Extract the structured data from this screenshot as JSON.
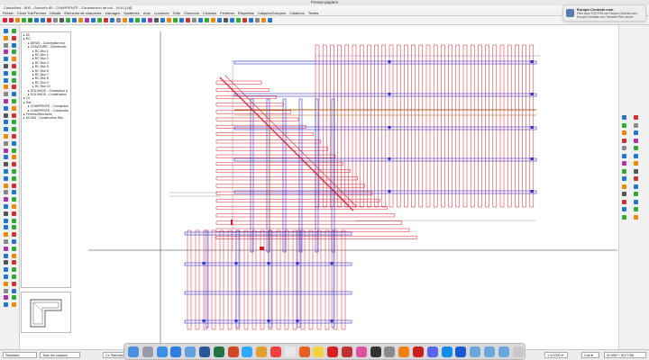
{
  "window": {
    "title": "Presse-papiers"
  },
  "app": {
    "line": "CadwWork - 806 - Oaknut's 80 - CHARPENTE - Construction de toit - 16:01 [48]"
  },
  "menu": {
    "items": [
      "Fichier",
      "Choix Toit/Fermes",
      "Détails",
      "Éléments de charpente",
      "Usinages",
      "Systèmes",
      "Auto",
      "Lucarnes",
      "Toits",
      "Chevrons",
      "Cloisons",
      "Fenêtres",
      "Étiquettes",
      "Calques/Groupes",
      "Cotations",
      "Textes"
    ]
  },
  "notification": {
    "title": "Europe-Centrale.com",
    "body": "Files sync TOUTOS sur Europe-Centrale.com - Europe-Centrale.com Transfert Retr-server"
  },
  "tree": {
    "items": [
      {
        "label": "63",
        "indent": 0
      },
      {
        "label": "RC",
        "indent": 0
      },
      {
        "label": "DIRUS - Conception mur",
        "indent": 1
      },
      {
        "label": "OSSATURE - Constructio",
        "indent": 1
      },
      {
        "label": "RC Mur 1",
        "indent": 2
      },
      {
        "label": "RC Mur 2",
        "indent": 2
      },
      {
        "label": "RC Mur 3",
        "indent": 2
      },
      {
        "label": "RC Mur 4",
        "indent": 2
      },
      {
        "label": "RC Mur 5",
        "indent": 2
      },
      {
        "label": "RC Mur 6",
        "indent": 2
      },
      {
        "label": "RC Mur 7",
        "indent": 2
      },
      {
        "label": "RC Mur 8",
        "indent": 2
      },
      {
        "label": "RC Mur 9",
        "indent": 2
      },
      {
        "label": "RC Mur 10",
        "indent": 2
      },
      {
        "label": "SOLIVAGE - Conception p",
        "indent": 1
      },
      {
        "label": "SOLIVAGE - Construction",
        "indent": 1
      },
      {
        "label": "Co",
        "indent": 0
      },
      {
        "label": "Toit",
        "indent": 0
      },
      {
        "label": "CHARPENTE - Conception",
        "indent": 1
      },
      {
        "label": "CHARPENTE - Constructio",
        "indent": 1
      },
      {
        "label": "Fermes/Structures",
        "indent": 0
      },
      {
        "label": "DICAM - Construction Stru",
        "indent": 0
      }
    ]
  },
  "statusbar": {
    "field1": "Standard",
    "field2": "Tous les calques",
    "field3": "Cx Standard",
    "field4": "1:1/1000 ▾",
    "field5": "Cali ▾",
    "field6": "St 8997 / 8977/56"
  },
  "colors": {
    "rafter": "#d81a2a",
    "beam": "#3232d2",
    "ridge": "#b06a1a",
    "accent": "#5a7ab0"
  },
  "dock": {
    "icons": [
      "finder",
      "launchpad",
      "safari",
      "app-store",
      "mail",
      "word",
      "excel",
      "powerpoint",
      "photoshop",
      "photos",
      "calendar",
      "chrome",
      "firefox",
      "notes",
      "acrobat",
      "pdf",
      "itunes",
      "terminal",
      "preferences",
      "vlc",
      "cadwork",
      "discord",
      "teamviewer",
      "docs",
      "folder",
      "folder",
      "downloads",
      "trash"
    ]
  }
}
